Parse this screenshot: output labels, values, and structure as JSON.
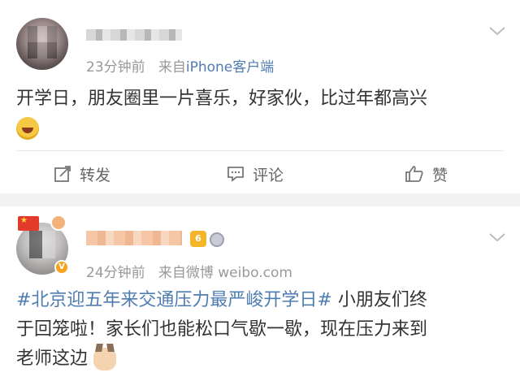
{
  "posts": [
    {
      "meta": {
        "time": "23分钟前",
        "source_prefix": "来自",
        "source": "iPhone客户端"
      },
      "content": {
        "line1": "开学日，朋友圈里一片喜乐，好家伙，比过年都高兴"
      },
      "emojis": [
        "laughing-crying-emoji"
      ],
      "actions": {
        "repost": "转发",
        "comment": "评论",
        "like": "赞"
      }
    },
    {
      "badges": {
        "level": "6"
      },
      "meta": {
        "time": "24分钟前",
        "source_prefix": "来自",
        "source": "微博 weibo.com"
      },
      "content": {
        "hashtag": "#北京迎五年来交通压力最严峻开学日#",
        "text_line1": "小朋友们终",
        "line2": "于回笼啦！家长们也能松口气歇一歇，现在压力来到",
        "line3": "老师这边"
      },
      "emojis": [
        "cat-face-emoji"
      ]
    }
  ],
  "icons": [
    "chevron-down-icon",
    "repost-icon",
    "comment-icon",
    "like-icon",
    "china-flag-icon",
    "verified-badge-icon",
    "medal-icon"
  ],
  "colors": {
    "link": "#507daf",
    "text": "#333333",
    "meta": "#999999",
    "background": "#f2f2f2"
  }
}
